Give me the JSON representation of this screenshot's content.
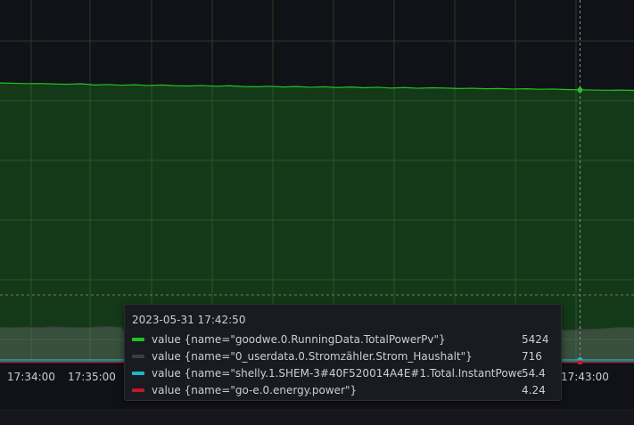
{
  "chart_data": {
    "type": "area",
    "x_ticks": [
      "17:34:00",
      "17:35:00",
      "17:43:00"
    ],
    "series": [
      {
        "name": "value {name=\"goodwe.0.RunningData.TotalPowerPv\"}",
        "color": "#1fc51f",
        "values": [
          5560,
          5555,
          5548,
          5550,
          5540,
          5535,
          5545,
          5520,
          5530,
          5515,
          5525,
          5510,
          5520,
          5505,
          5500,
          5510,
          5495,
          5505,
          5490,
          5485,
          5495,
          5480,
          5490,
          5475,
          5485,
          5470,
          5480,
          5465,
          5475,
          5460,
          5470,
          5455,
          5465,
          5460,
          5450,
          5455,
          5445,
          5450,
          5440,
          5445,
          5435,
          5440,
          5430,
          5424,
          5420,
          5415,
          5418,
          5412
        ]
      },
      {
        "name": "value {name=\"0_userdata.0.Stromzähler.Strom_Haushalt\"}",
        "color": "#3d3e44",
        "values": [
          700,
          690,
          705,
          695,
          710,
          700,
          690,
          705,
          715,
          700,
          260,
          260,
          720,
          730,
          740,
          735,
          730,
          745,
          740,
          735,
          745,
          740,
          750,
          745,
          740,
          735,
          730,
          735,
          725,
          730,
          720,
          725,
          715,
          720,
          710,
          715,
          720,
          725,
          720,
          715,
          716,
          650,
          640,
          655,
          665,
          680,
          700,
          695
        ]
      },
      {
        "name": "value {name=\"shelly.1.SHEM-3#40F520014A4E#1.Total.InstantPower\"}",
        "color": "#22b5c9",
        "values": [
          54.4,
          54.4,
          54.4,
          54.4,
          54.4,
          54.4,
          54.4,
          54.4,
          54.4,
          54.4,
          54.4,
          54.4,
          54.4,
          54.4,
          54.4,
          54.4,
          54.4,
          54.4,
          54.4,
          54.4,
          54.4,
          54.4,
          54.4,
          54.4,
          54.4,
          54.4,
          54.4,
          54.4,
          54.4,
          54.4,
          54.4,
          54.4,
          54.4,
          54.4,
          54.4,
          54.4,
          54.4,
          54.4,
          54.4,
          54.4,
          54.4,
          54.4,
          54.4,
          54.4,
          54.4,
          54.4,
          54.4,
          54.4
        ]
      },
      {
        "name": "value {name=\"go-e.0.energy.power\"}",
        "color": "#c4162a",
        "values": [
          4.24,
          4.24,
          4.24,
          4.24,
          4.24,
          4.24,
          4.24,
          4.24,
          4.24,
          4.24,
          4.24,
          4.24,
          4.24,
          4.24,
          4.24,
          4.24,
          4.24,
          4.24,
          4.24,
          4.24,
          4.24,
          4.24,
          4.24,
          4.24,
          4.24,
          4.24,
          4.24,
          4.24,
          4.24,
          4.24,
          4.24,
          4.24,
          4.24,
          4.24,
          4.24,
          4.24,
          4.24,
          4.24,
          4.24,
          4.24,
          4.24,
          4.24,
          4.24,
          4.24,
          4.24,
          4.24,
          4.24,
          4.24
        ]
      }
    ],
    "hover_index": 43,
    "grid": true,
    "legend": "none",
    "colors": {
      "background": "#111217",
      "grid": "#24262b",
      "crosshair": "#8e8e8e"
    }
  },
  "tooltip": {
    "time": "2023-05-31 17:42:50",
    "rows": [
      {
        "label": "value {name=\"goodwe.0.RunningData.TotalPowerPv\"}",
        "value": "5424",
        "color": "#1fc51f"
      },
      {
        "label": "value {name=\"0_userdata.0.Stromzähler.Strom_Haushalt\"}",
        "value": "716",
        "color": "#3d3e44"
      },
      {
        "label": "value {name=\"shelly.1.SHEM-3#40F520014A4E#1.Total.InstantPower\"}",
        "value": "54.4",
        "color": "#22b5c9"
      },
      {
        "label": "value {name=\"go-e.0.energy.power\"}",
        "value": "4.24",
        "color": "#c4162a"
      }
    ]
  }
}
